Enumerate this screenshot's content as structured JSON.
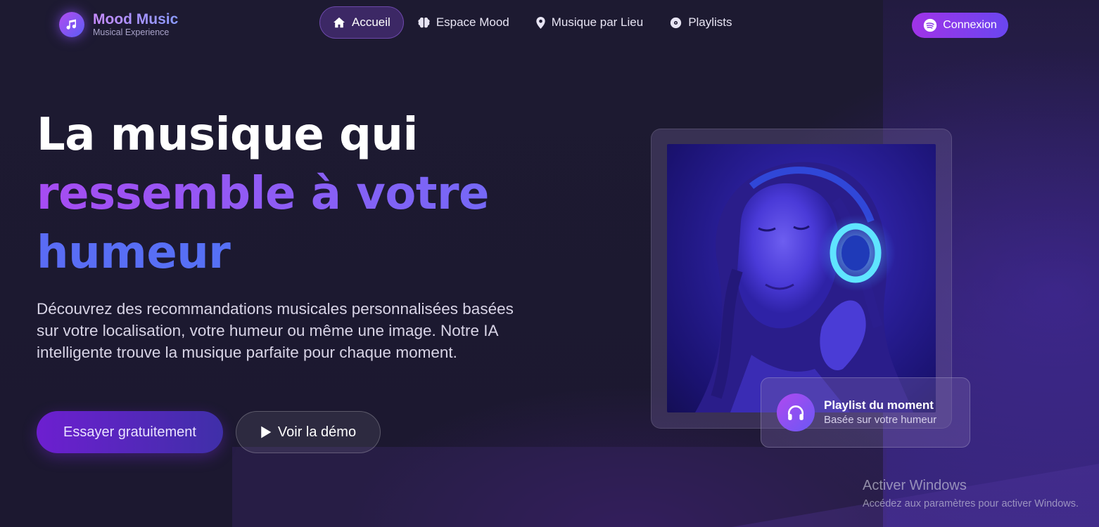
{
  "brand": {
    "name": "Mood Music",
    "tagline": "Musical Experience",
    "logo_icon": "music-note-icon"
  },
  "nav": {
    "items": [
      {
        "label": "Accueil",
        "icon": "home-icon",
        "active": true
      },
      {
        "label": "Espace Mood",
        "icon": "brain-icon",
        "active": false
      },
      {
        "label": "Musique par Lieu",
        "icon": "map-pin-icon",
        "active": false
      },
      {
        "label": "Playlists",
        "icon": "disc-icon",
        "active": false
      }
    ],
    "login_label": "Connexion",
    "login_icon": "spotify-icon"
  },
  "hero": {
    "title_line1": "La musique qui",
    "title_line2": "ressemble à votre",
    "title_line3": "humeur",
    "description": "Découvrez des recommandations musicales personnalisées basées sur votre localisation, votre humeur ou même une image. Notre IA intelligente trouve la musique parfaite pour chaque moment.",
    "cta_primary": "Essayer gratuitement",
    "cta_secondary": "Voir la démo"
  },
  "playlist_card": {
    "title": "Playlist du moment",
    "subtitle": "Basée sur votre humeur",
    "icon": "headphones-icon"
  },
  "windows_watermark": {
    "title": "Activer Windows",
    "subtitle": "Accédez aux paramètres pour activer Windows."
  },
  "colors": {
    "background": "#1c1830",
    "accent_purple": "#a033e8",
    "accent_blue": "#5b6cf6"
  }
}
